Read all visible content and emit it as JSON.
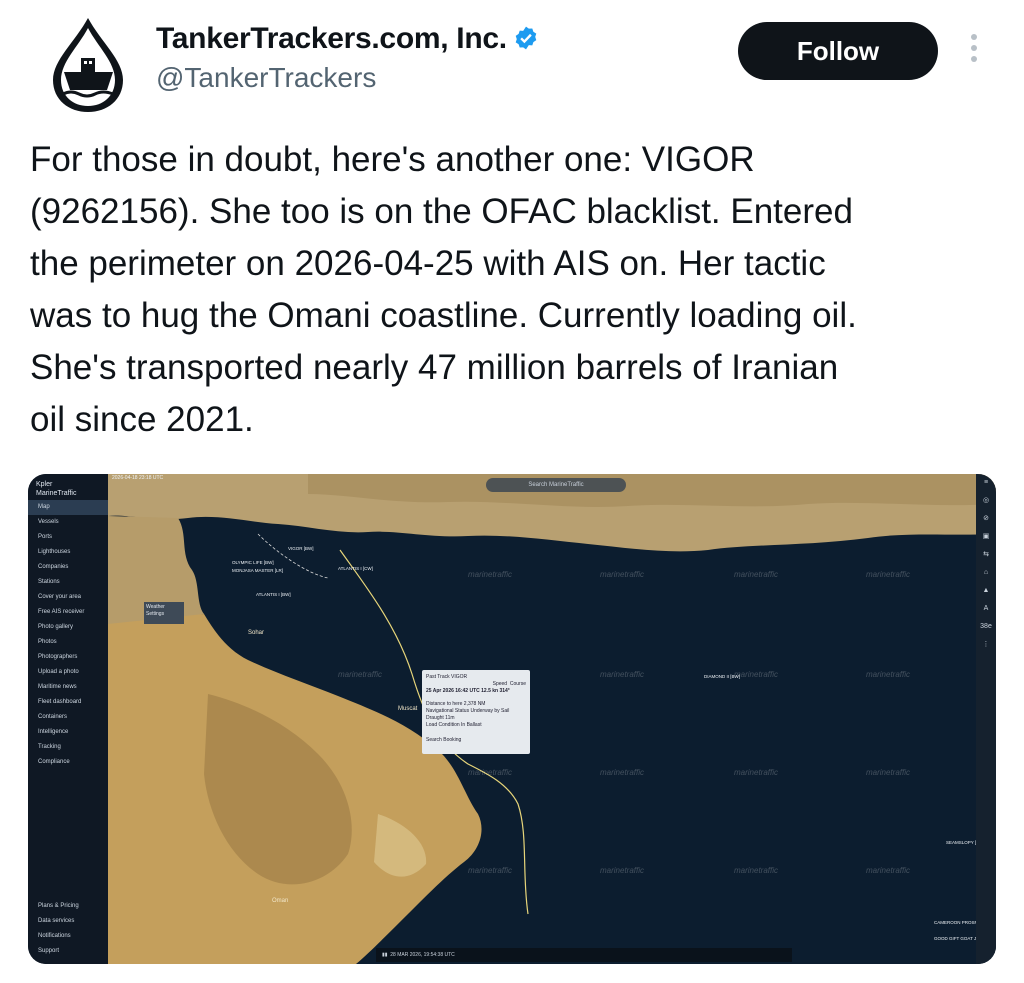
{
  "author": {
    "display_name": "TankerTrackers.com, Inc.",
    "handle": "@TankerTrackers",
    "avatar_icon": "oil-drop-tanker-icon",
    "verified_icon": "verified-badge-icon",
    "verified_color": "#1d9bf0"
  },
  "actions": {
    "follow_label": "Follow",
    "more_icon": "more-vertical-icon"
  },
  "tweet": {
    "lines": [
      "For those in doubt, here's another one: VIGOR",
      "(9262156). She too is on the OFAC blacklist. Entered",
      "the perimeter on 2026-04-25 with AIS on. Her tactic",
      "was to hug the Omani coastline. Currently loading oil.",
      "She's transported nearly 47 million barrels of Iranian",
      "oil since 2021."
    ]
  },
  "media": {
    "app_brand": "Kpler",
    "app_sub": "MarineTraffic",
    "sidebar_items": [
      "Map",
      "Vessels",
      "Ports",
      "Lighthouses",
      "Companies",
      "Stations",
      "Cover your area",
      "Free AIS receiver",
      "Photo gallery",
      "Photos",
      "Photographers",
      "Upload a photo",
      "Maritime news",
      "Fleet dashboard",
      "Containers",
      "Intelligence",
      "Tracking",
      "Compliance"
    ],
    "sidebar_bottom": [
      "Plans & Pricing",
      "Data services",
      "Notifications",
      "Support"
    ],
    "search_placeholder": "Search MarineTraffic",
    "weather_label": "Weather Settings",
    "top_timestamp": "2026-04-18 23:18 UTC",
    "watermark": "marinetraffic",
    "places": [
      "Sohar",
      "Muscat",
      "Oman"
    ],
    "popup": {
      "title": "Past Track VIGOR",
      "col_speed": "Speed",
      "col_course": "Course",
      "row": "25 Apr 2026 16:42 UTC  12.5 kn  314°",
      "distance": "Distance to here  2,378 NM",
      "status": "Navigational Status  Underway by Sail",
      "draught": "Draught  11m",
      "load": "Load Condition  In Ballast",
      "footer": "Search Booking"
    },
    "vessel_labels": [
      "VIGOR [BW]",
      "OLYMPIC LIFE [BW]",
      "MONJASA MASTER [LR]",
      "ATLANTIS I [CW]",
      "ATLANTIS I [BW]",
      "DIAMOND II [BW]",
      "SEAMSLOPY [MT]",
      "CAMEROON PROSPERITY",
      "GOOD GIFT GOAT JJ [BW]"
    ],
    "player_time": "28 MAR 2026, 19:54:38 UTC",
    "right_controls": [
      "≡",
      "◎",
      "⊘",
      "▣",
      "⇆",
      "⌂",
      "▲",
      "A",
      "38e",
      "⋮"
    ]
  }
}
